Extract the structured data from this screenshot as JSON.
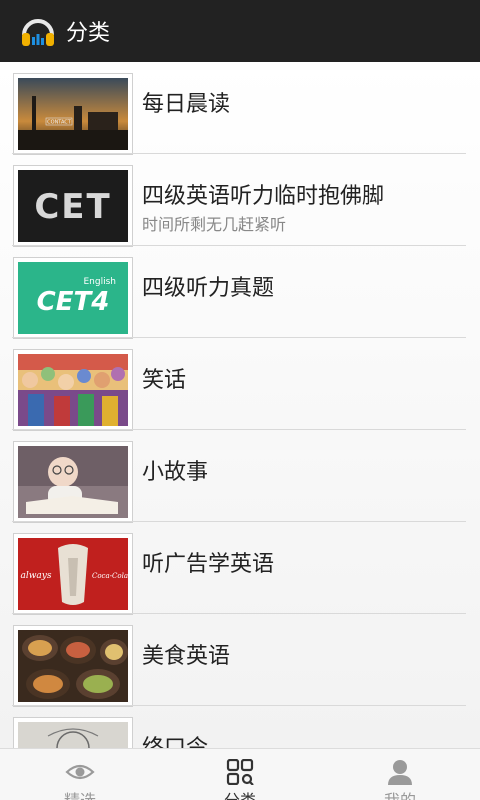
{
  "header": {
    "title": "分类",
    "app_icon": "headphones-icon"
  },
  "categories": [
    {
      "title": "每日晨读",
      "subtitle": "",
      "thumb": "sunset-cityscape-image",
      "thumb_text": "CONTACT"
    },
    {
      "title": "四级英语听力临时抱佛脚",
      "subtitle": "时间所剩无几赶紧听",
      "thumb": "cet-logo-image",
      "thumb_text": "CET"
    },
    {
      "title": "四级听力真题",
      "subtitle": "",
      "thumb": "cet4-english-image",
      "thumb_text": "CET4",
      "thumb_text2": "English"
    },
    {
      "title": "笑话",
      "subtitle": "",
      "thumb": "cartoon-crowd-image"
    },
    {
      "title": "小故事",
      "subtitle": "",
      "thumb": "baby-reading-image"
    },
    {
      "title": "听广告学英语",
      "subtitle": "",
      "thumb": "ads-image",
      "thumb_text": "always",
      "thumb_text2": "Coca-Cola"
    },
    {
      "title": "美食英语",
      "subtitle": "",
      "thumb": "food-image"
    },
    {
      "title": "终口令",
      "subtitle": "",
      "thumb": "sketch-image"
    }
  ],
  "tabs": [
    {
      "label": "精选",
      "icon": "eye-icon",
      "active": false
    },
    {
      "label": "分类",
      "icon": "category-grid-icon",
      "active": true
    },
    {
      "label": "我的",
      "icon": "person-icon",
      "active": false
    }
  ],
  "colors": {
    "topbar": "#222222",
    "cet4_green": "#2bb58a",
    "ad_red": "#c0201e"
  }
}
